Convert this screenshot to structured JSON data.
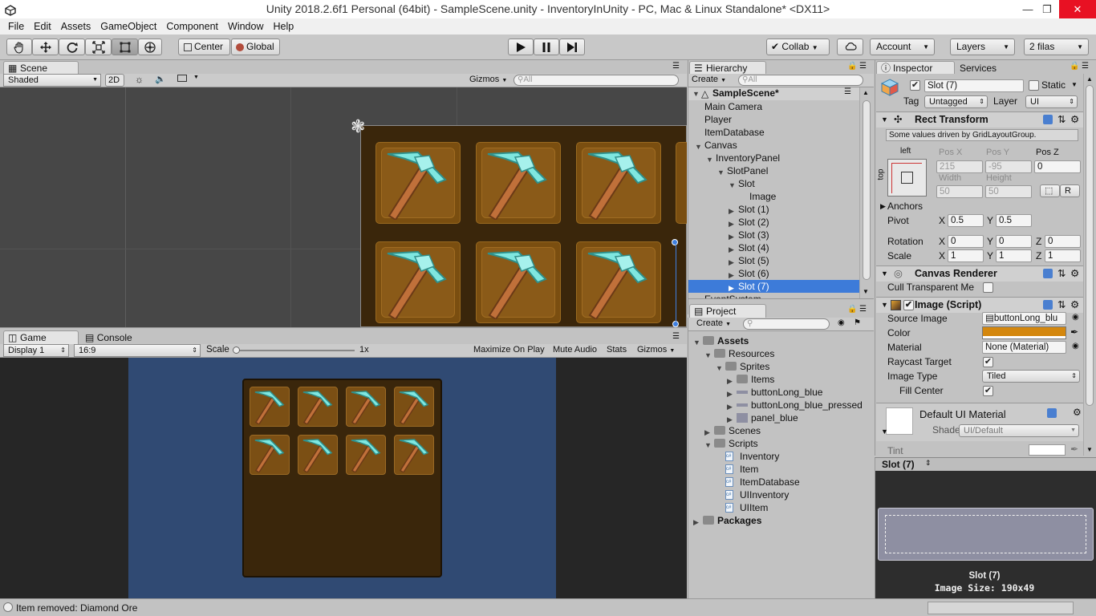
{
  "window": {
    "title": "Unity 2018.2.6f1 Personal (64bit) - SampleScene.unity - InventoryInUnity - PC, Mac & Linux Standalone* <DX11>",
    "controls": [
      "minimize-icon",
      "restore-icon",
      "close-icon"
    ]
  },
  "menu": [
    "File",
    "Edit",
    "Assets",
    "GameObject",
    "Component",
    "Window",
    "Help"
  ],
  "toolbar": {
    "tools": [
      "hand-icon",
      "move-icon",
      "rotate-icon",
      "scale-icon",
      "rect-icon",
      "transform-icon"
    ],
    "pivot_mode": "Center",
    "pivot_rotation": "Global",
    "play": [
      "play-icon",
      "pause-icon",
      "step-icon"
    ],
    "collab": "Collab",
    "account": "Account",
    "layers": "Layers",
    "layout": "2 filas"
  },
  "scene": {
    "tab": "Scene",
    "shading": "Shaded",
    "mode_2d": "2D",
    "gizmos": "Gizmos",
    "search_placeholder": "All"
  },
  "game": {
    "tabs": [
      "Game",
      "Console"
    ],
    "display": "Display 1",
    "aspect": "16:9",
    "scale_label": "Scale",
    "scale_value": "1x",
    "maximize": "Maximize On Play",
    "mute": "Mute Audio",
    "stats": "Stats",
    "gizmos": "Gizmos"
  },
  "hierarchy": {
    "tab": "Hierarchy",
    "create": "Create",
    "search_placeholder": "All",
    "scene_name": "SampleScene*",
    "items": [
      {
        "label": "Main Camera",
        "depth": 1,
        "arrow": ""
      },
      {
        "label": "Player",
        "depth": 1,
        "arrow": ""
      },
      {
        "label": "ItemDatabase",
        "depth": 1,
        "arrow": ""
      },
      {
        "label": "Canvas",
        "depth": 1,
        "arrow": "down"
      },
      {
        "label": "InventoryPanel",
        "depth": 2,
        "arrow": "down"
      },
      {
        "label": "SlotPanel",
        "depth": 3,
        "arrow": "down"
      },
      {
        "label": "Slot",
        "depth": 4,
        "arrow": "down"
      },
      {
        "label": "Image",
        "depth": 5,
        "arrow": ""
      },
      {
        "label": "Slot (1)",
        "depth": 4,
        "arrow": "right"
      },
      {
        "label": "Slot (2)",
        "depth": 4,
        "arrow": "right"
      },
      {
        "label": "Slot (3)",
        "depth": 4,
        "arrow": "right"
      },
      {
        "label": "Slot (4)",
        "depth": 4,
        "arrow": "right"
      },
      {
        "label": "Slot (5)",
        "depth": 4,
        "arrow": "right"
      },
      {
        "label": "Slot (6)",
        "depth": 4,
        "arrow": "right"
      },
      {
        "label": "Slot (7)",
        "depth": 4,
        "arrow": "right",
        "selected": true
      },
      {
        "label": "EventSystem",
        "depth": 1,
        "arrow": ""
      }
    ]
  },
  "project": {
    "tab": "Project",
    "create": "Create",
    "items": [
      {
        "label": "Assets",
        "depth": 0,
        "kind": "folder",
        "arrow": "down",
        "bold": true
      },
      {
        "label": "Resources",
        "depth": 1,
        "kind": "folder",
        "arrow": "down"
      },
      {
        "label": "Sprites",
        "depth": 2,
        "kind": "folder",
        "arrow": "down"
      },
      {
        "label": "Items",
        "depth": 3,
        "kind": "folder",
        "arrow": "right"
      },
      {
        "label": "buttonLong_blue",
        "depth": 3,
        "kind": "sprite",
        "arrow": "right"
      },
      {
        "label": "buttonLong_blue_pressed",
        "depth": 3,
        "kind": "sprite",
        "arrow": "right"
      },
      {
        "label": "panel_blue",
        "depth": 3,
        "kind": "sprite",
        "arrow": "right"
      },
      {
        "label": "Scenes",
        "depth": 1,
        "kind": "folder",
        "arrow": "right"
      },
      {
        "label": "Scripts",
        "depth": 1,
        "kind": "folder",
        "arrow": "down"
      },
      {
        "label": "Inventory",
        "depth": 2,
        "kind": "script",
        "arrow": ""
      },
      {
        "label": "Item",
        "depth": 2,
        "kind": "script",
        "arrow": ""
      },
      {
        "label": "ItemDatabase",
        "depth": 2,
        "kind": "script",
        "arrow": ""
      },
      {
        "label": "UIInventory",
        "depth": 2,
        "kind": "script",
        "arrow": ""
      },
      {
        "label": "UIItem",
        "depth": 2,
        "kind": "script",
        "arrow": ""
      },
      {
        "label": "Packages",
        "depth": 0,
        "kind": "folder",
        "arrow": "right",
        "bold": true
      }
    ]
  },
  "inspector": {
    "tabs": [
      "Inspector",
      "Services"
    ],
    "object_name": "Slot (7)",
    "static": "Static",
    "tag_label": "Tag",
    "tag_value": "Untagged",
    "layer_label": "Layer",
    "layer_value": "UI",
    "rect_transform": {
      "title": "Rect Transform",
      "note": "Some values driven by GridLayoutGroup.",
      "anchor_h": "left",
      "anchor_v": "top",
      "pos_x_label": "Pos X",
      "pos_x": "215",
      "pos_y_label": "Pos Y",
      "pos_y": "-95",
      "pos_z_label": "Pos Z",
      "pos_z": "0",
      "width_label": "Width",
      "width": "50",
      "height_label": "Height",
      "height": "50",
      "r_button": "R",
      "anchors": "Anchors",
      "pivot_label": "Pivot",
      "pivot_x": "0.5",
      "pivot_y": "0.5",
      "rotation_label": "Rotation",
      "rot_x": "0",
      "rot_y": "0",
      "rot_z": "0",
      "scale_label": "Scale",
      "scale_x": "1",
      "scale_y": "1",
      "scale_z": "1",
      "x": "X",
      "y": "Y",
      "z": "Z"
    },
    "canvas_renderer": {
      "title": "Canvas Renderer",
      "cull_label": "Cull Transparent Me"
    },
    "image": {
      "title": "Image (Script)",
      "source_label": "Source Image",
      "source_value": "buttonLong_blu",
      "color_label": "Color",
      "color": "#d4870e",
      "material_label": "Material",
      "material_value": "None (Material)",
      "raycast_label": "Raycast Target",
      "type_label": "Image Type",
      "type_value": "Tiled",
      "fill_label": "Fill Center"
    },
    "material": {
      "name": "Default UI Material",
      "shader_label": "Shader",
      "shader_value": "UI/Default",
      "tint_label": "Tint"
    },
    "preview": {
      "title": "Slot (7)",
      "caption_name": "Slot (7)",
      "caption_size": "Image Size: 190x49"
    }
  },
  "status": {
    "message": "Item removed: Diamond Ore"
  },
  "colors": {
    "selection": "#3d7bd9",
    "panel_brown": "#3a260b",
    "game_bg": "#304a73"
  }
}
